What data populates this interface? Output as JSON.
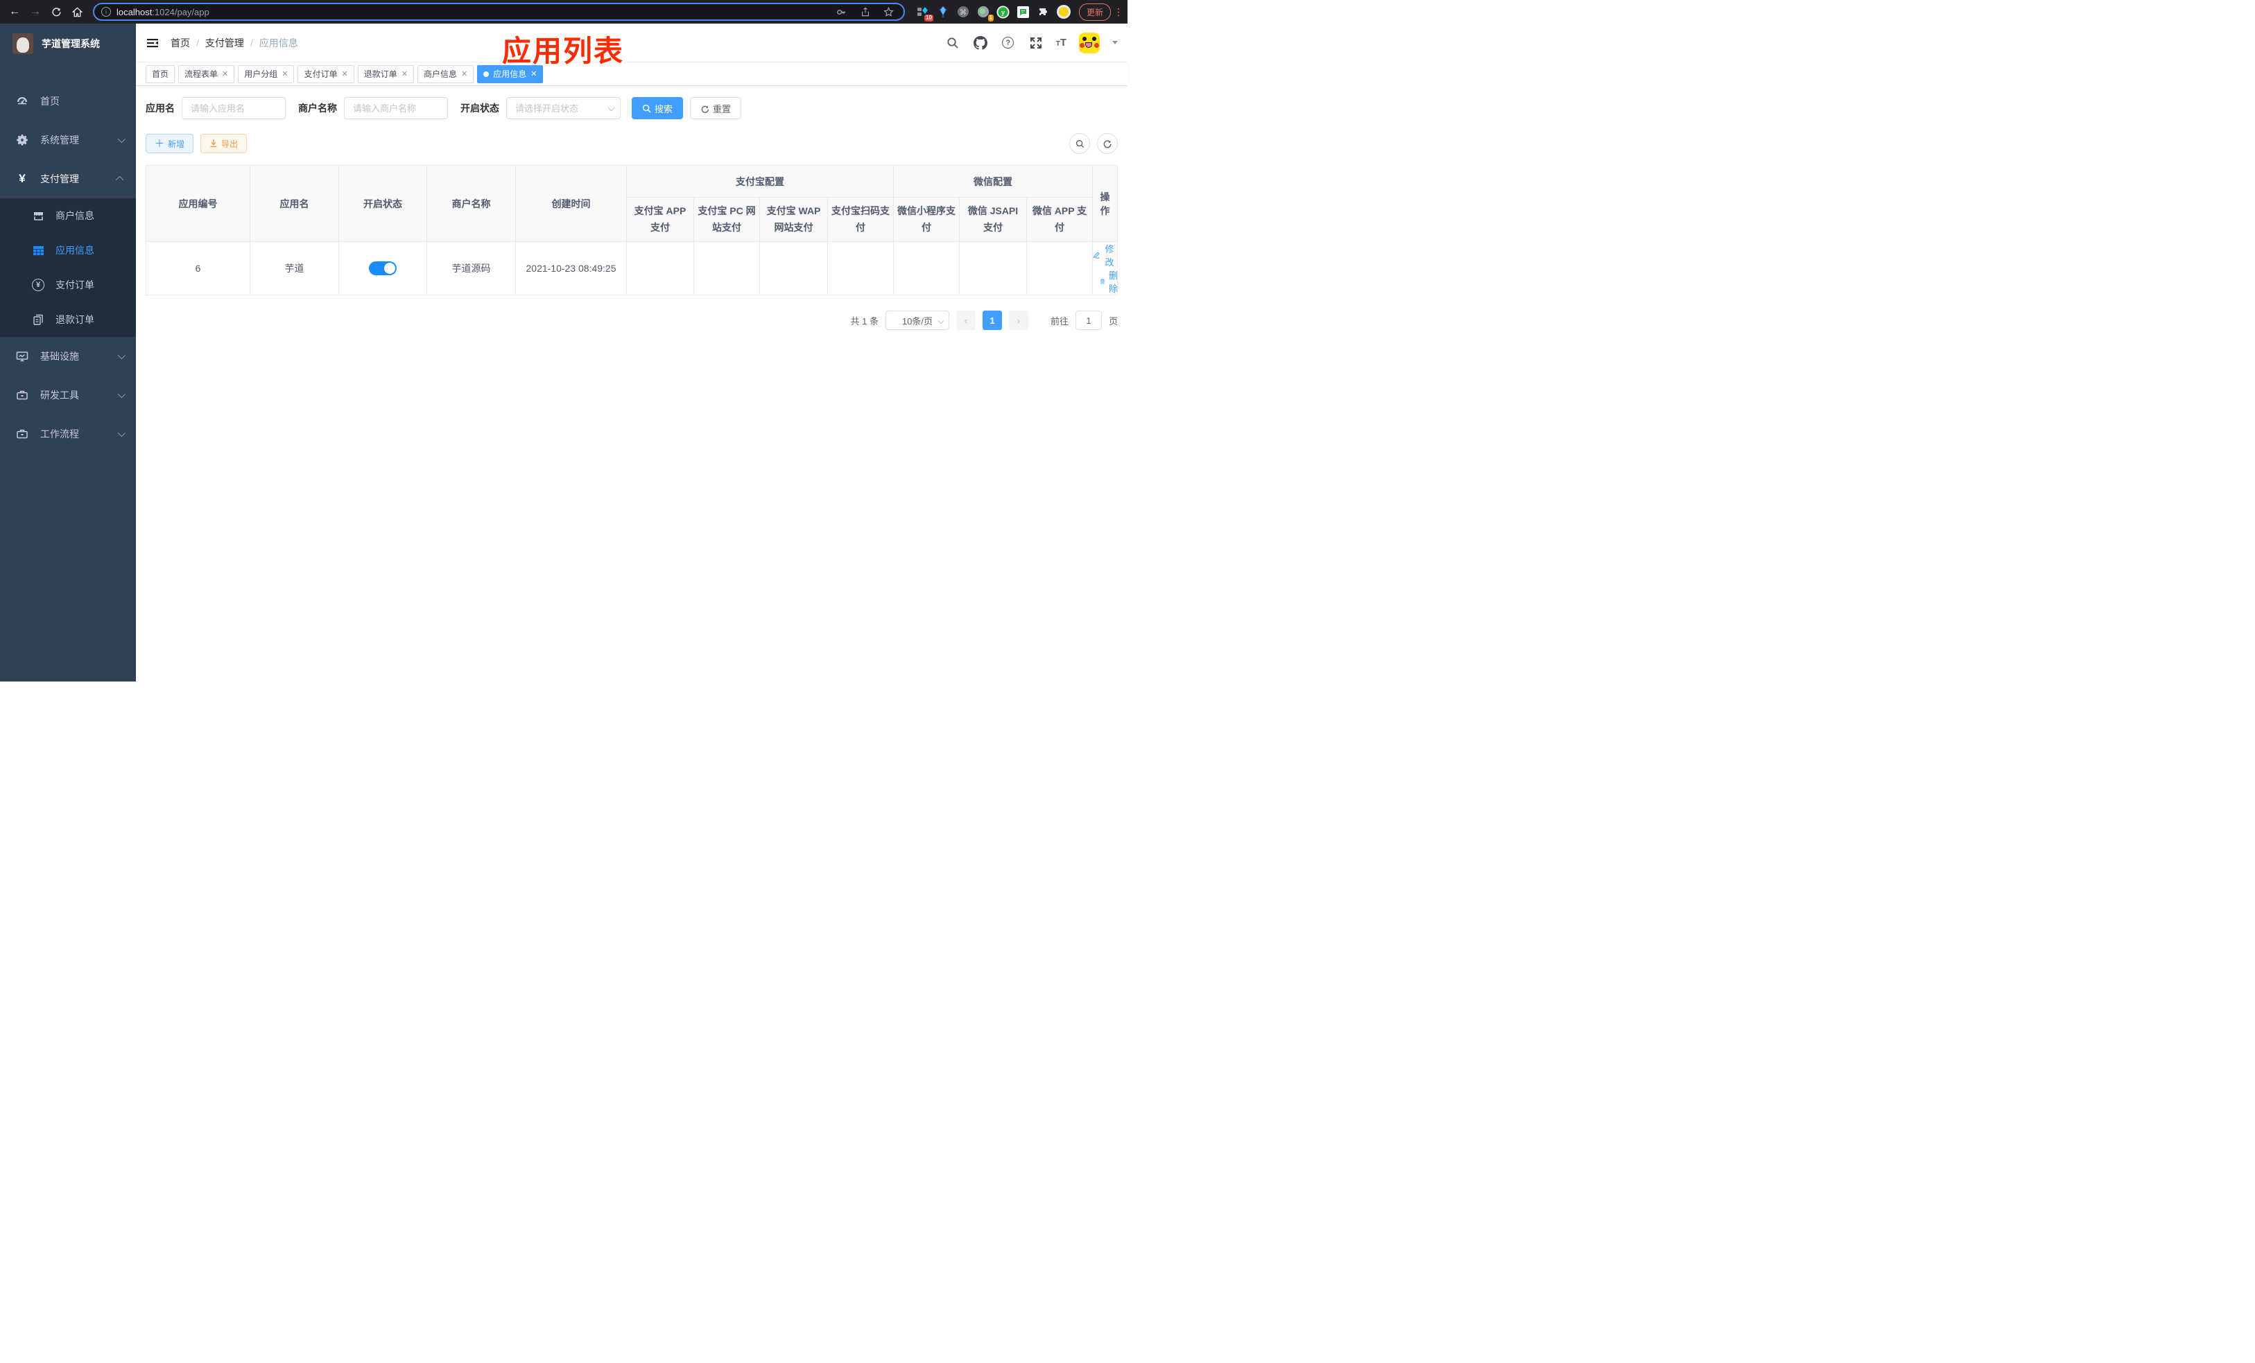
{
  "browser": {
    "url_host": "localhost",
    "url_path": ":1024/pay/app",
    "update_label": "更新",
    "ext_badge_1": "10",
    "ext_badge_2": "1"
  },
  "sidebar": {
    "title": "芋道管理系统",
    "items": [
      "首页",
      "系统管理",
      "支付管理",
      "基础设施",
      "研发工具",
      "工作流程"
    ],
    "submenu": [
      "商户信息",
      "应用信息",
      "支付订单",
      "退款订单"
    ]
  },
  "header": {
    "breadcrumb": [
      "首页",
      "支付管理",
      "应用信息"
    ],
    "annotation": "应用列表"
  },
  "tabs": [
    {
      "label": "首页",
      "closable": false,
      "active": false
    },
    {
      "label": "流程表单",
      "closable": true,
      "active": false
    },
    {
      "label": "用户分组",
      "closable": true,
      "active": false
    },
    {
      "label": "支付订单",
      "closable": true,
      "active": false
    },
    {
      "label": "退款订单",
      "closable": true,
      "active": false
    },
    {
      "label": "商户信息",
      "closable": true,
      "active": false
    },
    {
      "label": "应用信息",
      "closable": true,
      "active": true
    }
  ],
  "filters": {
    "app_name_label": "应用名",
    "app_name_placeholder": "请输入应用名",
    "merchant_label": "商户名称",
    "merchant_placeholder": "请输入商户名称",
    "status_label": "开启状态",
    "status_placeholder": "请选择开启状态",
    "search_label": "搜索",
    "reset_label": "重置"
  },
  "toolbar": {
    "add_label": "新增",
    "export_label": "导出"
  },
  "table": {
    "columns": [
      "应用编号",
      "应用名",
      "开启状态",
      "商户名称",
      "创建时间"
    ],
    "group_alipay": {
      "label": "支付宝配置",
      "children": [
        "支付宝 APP 支付",
        "支付宝 PC 网站支付",
        "支付宝 WAP 网站支付",
        "支付宝扫码支付"
      ]
    },
    "group_wechat": {
      "label": "微信配置",
      "children": [
        "微信小程序支付",
        "微信 JSAPI 支付",
        "微信 APP 支付"
      ]
    },
    "actions_label": "操作",
    "rows": [
      {
        "id": "6",
        "name": "芋道",
        "enabled": true,
        "merchant": "芋道源码",
        "created": "2021-10-23 08:49:25",
        "statuses": [
          "no",
          "no",
          "no",
          "no",
          "no",
          "yes",
          "no"
        ],
        "edit_label": "修改",
        "delete_label": "删除"
      }
    ]
  },
  "pagination": {
    "total": "共 1 条",
    "page_size": "10条/页",
    "current_page": "1",
    "goto_label": "前往",
    "goto_value": "1",
    "page_unit": "页"
  },
  "colors": {
    "accent": "#409eff",
    "sidebar_bg": "#304156",
    "submenu_bg": "#1f2d3d",
    "status_off": "#f44f4f",
    "status_on": "#13ce66",
    "annotation": "#ff2b00"
  }
}
